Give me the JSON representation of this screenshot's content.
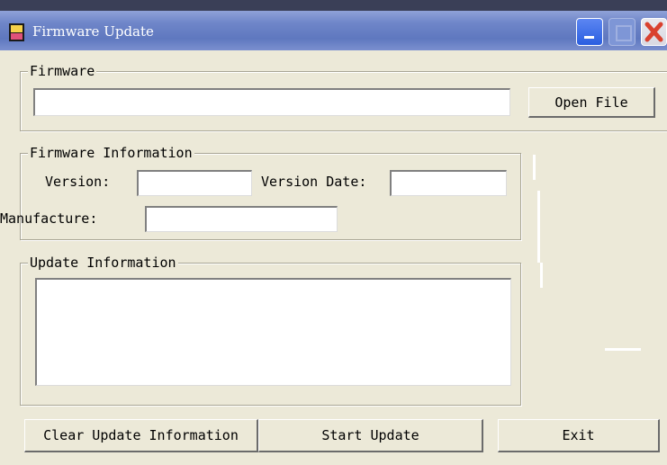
{
  "window": {
    "title": "Firmware Update"
  },
  "firmware_group": {
    "legend": "Firmware",
    "path_value": "",
    "open_file_label": "Open File"
  },
  "info_group": {
    "legend": "Firmware Information",
    "version_label": "Version:",
    "version_value": "",
    "version_date_label": "Version Date:",
    "version_date_value": "",
    "manufacture_label": "Manufacture:",
    "manufacture_value": ""
  },
  "update_group": {
    "legend": "Update Information",
    "log_value": ""
  },
  "buttons": {
    "clear_label": "Clear Update Information",
    "start_label": "Start Update",
    "exit_label": "Exit"
  },
  "colors": {
    "title_bar": "#6f86c9",
    "window_bg": "#ece9d8",
    "close_x": "#d9412f"
  }
}
